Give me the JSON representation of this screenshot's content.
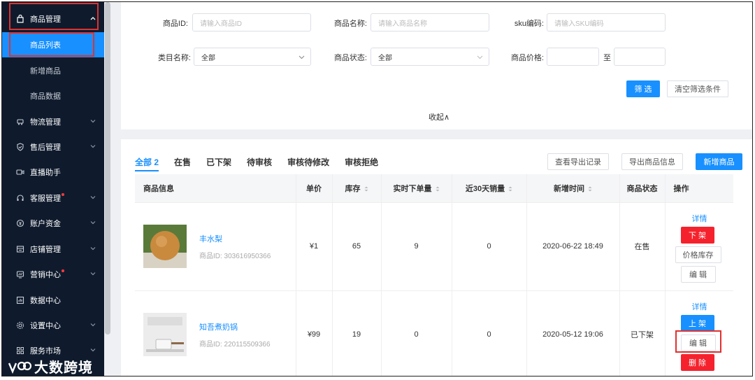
{
  "sidebar": {
    "items": [
      {
        "label": "商品管理",
        "icon": "shopping-bag-icon",
        "expanded": true
      },
      {
        "label": "商品列表",
        "sub": true,
        "active": true
      },
      {
        "label": "新增商品",
        "sub": true
      },
      {
        "label": "商品数据",
        "sub": true
      },
      {
        "label": "物流管理",
        "icon": "truck-icon"
      },
      {
        "label": "售后管理",
        "icon": "shield-icon"
      },
      {
        "label": "直播助手",
        "icon": "video-icon"
      },
      {
        "label": "客服管理",
        "icon": "headset-icon",
        "dot": true
      },
      {
        "label": "账户资金",
        "icon": "coin-icon"
      },
      {
        "label": "店铺管理",
        "icon": "store-icon"
      },
      {
        "label": "营销中心",
        "icon": "megaphone-icon",
        "dot": true
      },
      {
        "label": "数据中心",
        "icon": "chart-icon"
      },
      {
        "label": "设置中心",
        "icon": "gear-icon"
      },
      {
        "label": "服务市场",
        "icon": "grid-icon"
      }
    ],
    "logo_text": "大数跨境"
  },
  "filters": {
    "product_id_label": "商品ID:",
    "product_id_placeholder": "请输入商品ID",
    "product_name_label": "商品名称:",
    "product_name_placeholder": "请输入商品名称",
    "sku_label": "sku编码:",
    "sku_placeholder": "请输入SKU编码",
    "category_label": "类目名称:",
    "category_value": "全部",
    "status_label": "商品状态:",
    "status_value": "全部",
    "price_label": "商品价格:",
    "price_to": "至",
    "filter_button": "筛 选",
    "clear_button": "清空筛选条件",
    "collapse": "收起∧"
  },
  "tabs": [
    "全部 2",
    "在售",
    "已下架",
    "待审核",
    "审核待修改",
    "审核拒绝"
  ],
  "actions": {
    "export_records": "查看导出记录",
    "export_products": "导出商品信息",
    "add_product": "新增商品"
  },
  "table": {
    "headers": [
      "商品信息",
      "单价",
      "库存",
      "实时下单量",
      "近30天销量",
      "新增时间",
      "商品状态",
      "操作"
    ],
    "rows": [
      {
        "name": "丰水梨",
        "id": "商品ID: 303616950366",
        "price": "¥1",
        "stock": "65",
        "orders": "9",
        "sales30": "0",
        "created": "2020-06-22 18:49",
        "status": "在售",
        "ops": [
          "详情",
          "下 架",
          "价格库存",
          "编 辑"
        ]
      },
      {
        "name": "知吾煮奶锅",
        "id": "商品ID: 220115509366",
        "price": "¥99",
        "stock": "19",
        "orders": "0",
        "sales30": "0",
        "created": "2020-05-12 19:06",
        "status": "已下架",
        "ops": [
          "详情",
          "上 架",
          "编 辑",
          "删 除"
        ]
      }
    ]
  },
  "colors": {
    "sidebar_bg": "#0f1b2d",
    "primary": "#1890ff",
    "danger": "#f5222d",
    "highlight": "#e0312f"
  }
}
